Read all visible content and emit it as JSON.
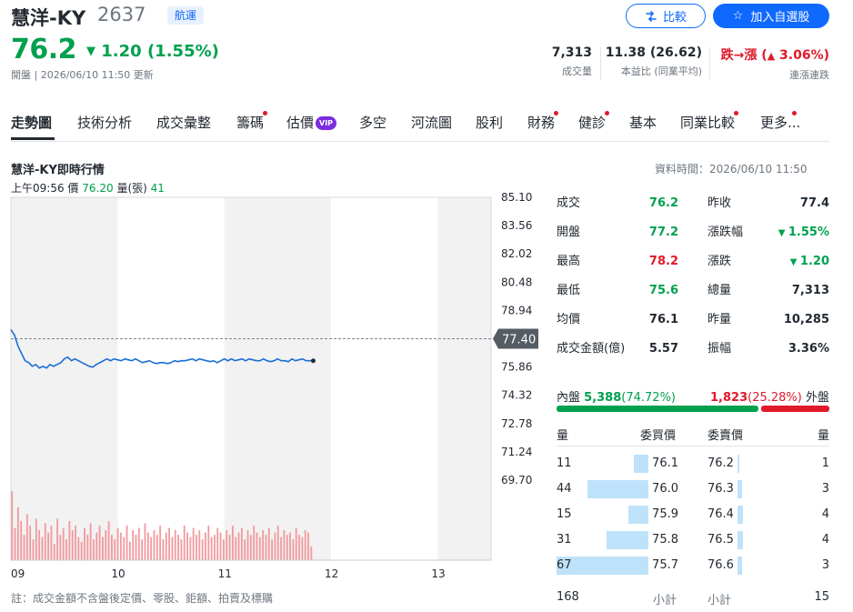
{
  "stock": {
    "name": "慧洋-KY",
    "code": "2637",
    "industry": "航運",
    "compare_label": "比較",
    "watchlist_label": "加入自選股",
    "price": "76.2",
    "change": "1.20 (1.55%)",
    "status_prefix": "開盤",
    "status_time": "2026/06/10 11:50 更新"
  },
  "key_stats": [
    {
      "value": "7,313",
      "label": "成交量"
    },
    {
      "value": "11.38 (26.62)",
      "label": "本益比 (同業平均)"
    },
    {
      "value_main": "跌→漲 (",
      "value_pct": "3.06%)",
      "label": "連漲連跌"
    }
  ],
  "tabs": [
    {
      "label": "走勢圖",
      "dot": false
    },
    {
      "label": "技術分析",
      "dot": false
    },
    {
      "label": "成交彙整",
      "dot": false
    },
    {
      "label": "籌碼",
      "dot": true
    },
    {
      "label": "估價",
      "dot": false
    },
    {
      "label": "多空",
      "dot": false
    },
    {
      "label": "河流圖",
      "dot": false
    },
    {
      "label": "股利",
      "dot": false
    },
    {
      "label": "財務",
      "dot": true
    },
    {
      "label": "健診",
      "dot": true
    },
    {
      "label": "基本",
      "dot": false
    },
    {
      "label": "同業比較",
      "dot": true
    },
    {
      "label": "更多...",
      "dot": true
    }
  ],
  "vip_badge": "VIP",
  "chart_header": {
    "title": "慧洋-KY即時行情",
    "data_time": "資料時間：2026/06/10 11:50",
    "cursor_time": "上午09:56",
    "cursor_price_label": "價",
    "cursor_price": "76.20",
    "cursor_volume_label": "量(張)",
    "cursor_volume": "41"
  },
  "chart_data": {
    "type": "line",
    "x_ticks": [
      "09",
      "10",
      "11",
      "12",
      "13"
    ],
    "y_ticks": [
      "85.10",
      "83.56",
      "82.02",
      "80.48",
      "78.94",
      "77.40",
      "75.86",
      "74.32",
      "72.78",
      "71.24",
      "69.70"
    ],
    "ylim": [
      69.7,
      85.1
    ],
    "reference": "77.40",
    "reference_value": 77.4,
    "x_range_minutes": 270,
    "price_series": {
      "minutes": [
        0,
        2,
        4,
        6,
        8,
        10,
        12,
        14,
        16,
        18,
        20,
        22,
        24,
        26,
        28,
        30,
        32,
        34,
        36,
        38,
        40,
        42,
        44,
        46,
        48,
        50,
        52,
        54,
        56,
        58,
        60,
        62,
        64,
        66,
        68,
        70,
        72,
        74,
        76,
        78,
        80,
        82,
        84,
        86,
        88,
        90,
        92,
        94,
        96,
        98,
        100,
        102,
        104,
        106,
        108,
        110,
        112,
        114,
        116,
        118,
        120,
        122,
        124,
        126,
        128,
        130,
        132,
        134,
        136,
        138,
        140,
        142,
        144,
        146,
        148,
        150,
        152,
        154,
        156,
        158,
        160,
        162,
        164,
        166,
        168,
        170
      ],
      "values": [
        77.9,
        77.6,
        77.0,
        76.6,
        76.2,
        76.1,
        75.9,
        76.0,
        75.8,
        75.9,
        75.8,
        76.0,
        75.9,
        76.0,
        76.1,
        76.3,
        76.4,
        76.2,
        76.3,
        76.2,
        76.1,
        76.0,
        75.9,
        75.85,
        76.0,
        76.1,
        76.2,
        76.3,
        76.2,
        76.3,
        76.25,
        76.2,
        76.3,
        76.25,
        76.2,
        76.3,
        76.2,
        76.1,
        76.15,
        76.2,
        76.1,
        76.05,
        76.1,
        76.1,
        76.05,
        76.1,
        76.2,
        76.15,
        76.2,
        76.2,
        76.25,
        76.3,
        76.2,
        76.3,
        76.25,
        76.2,
        76.15,
        76.2,
        76.1,
        76.2,
        76.3,
        76.2,
        76.3,
        76.2,
        76.25,
        76.3,
        76.2,
        76.3,
        76.25,
        76.2,
        76.2,
        76.3,
        76.2,
        76.15,
        76.2,
        76.3,
        76.2,
        76.2,
        76.15,
        76.3,
        76.2,
        76.25,
        76.3,
        76.2,
        76.2,
        76.2
      ]
    },
    "volume_series": [
      60,
      28,
      46,
      34,
      22,
      40,
      30,
      18,
      36,
      26,
      20,
      32,
      24,
      30,
      14,
      36,
      22,
      28,
      18,
      34,
      26,
      30,
      20,
      16,
      28,
      22,
      32,
      18,
      24,
      30,
      20,
      26,
      34,
      22,
      18,
      28,
      24,
      20,
      30,
      16,
      26,
      22,
      28,
      18,
      32,
      24,
      20,
      26,
      22,
      30,
      18,
      24,
      28,
      20,
      26,
      22,
      18,
      30,
      24,
      20,
      28,
      22,
      26,
      18,
      24,
      30,
      20,
      22,
      28,
      24,
      18,
      26,
      22,
      30,
      20,
      24,
      28,
      18,
      26,
      22,
      30,
      24,
      20,
      26,
      22,
      28,
      18,
      24,
      30,
      20,
      26,
      22,
      24,
      18,
      28,
      22,
      20,
      26,
      24,
      12
    ],
    "volume_max": 60,
    "last_point_minute": 170,
    "last_point_value": 76.2,
    "grid": true,
    "colors": {
      "line": "#1a6dd6",
      "volume": "#f29a9f",
      "shade": "#f2f2f2",
      "reference": "#7d8590",
      "ref_label_bg": "#555c63"
    }
  },
  "quote": {
    "left": [
      {
        "label": "成交",
        "value": "76.2",
        "color": "green"
      },
      {
        "label": "開盤",
        "value": "77.2",
        "color": "green"
      },
      {
        "label": "最高",
        "value": "78.2",
        "color": "red"
      },
      {
        "label": "最低",
        "value": "75.6",
        "color": "green"
      },
      {
        "label": "均價",
        "value": "76.1",
        "color": "black"
      },
      {
        "label": "成交金額(億)",
        "value": "5.57",
        "color": "black"
      }
    ],
    "right": [
      {
        "label": "昨收",
        "value": "77.4",
        "color": "black"
      },
      {
        "label": "漲跌幅",
        "value": "1.55%",
        "color": "green",
        "arrow": true
      },
      {
        "label": "漲跌",
        "value": "1.20",
        "color": "green",
        "arrow": true
      },
      {
        "label": "總量",
        "value": "7,313",
        "color": "black"
      },
      {
        "label": "昨量",
        "value": "10,285",
        "color": "black"
      },
      {
        "label": "振幅",
        "value": "3.36%",
        "color": "black"
      }
    ]
  },
  "inner_outer": {
    "inner_label": "內盤",
    "inner_value": "5,388",
    "inner_pct": "(74.72%)",
    "inner_ratio": 0.7472,
    "outer_value": "1,823",
    "outer_pct": "(25.28%)",
    "outer_label": "外盤",
    "colors": {
      "inner": "#00a04f",
      "outer": "#e0192b"
    }
  },
  "order_book": {
    "headers": {
      "bid_qty": "量",
      "bid_price": "委買價",
      "ask_price": "委賣價",
      "ask_qty": "量"
    },
    "bids": [
      {
        "qty": "11",
        "price": "76.1",
        "ratio": 0.16
      },
      {
        "qty": "44",
        "price": "76.0",
        "ratio": 0.66
      },
      {
        "qty": "15",
        "price": "75.9",
        "ratio": 0.22
      },
      {
        "qty": "31",
        "price": "75.8",
        "ratio": 0.46
      },
      {
        "qty": "67",
        "price": "75.7",
        "ratio": 1.0
      }
    ],
    "asks": [
      {
        "price": "76.2",
        "qty": "1",
        "ratio": 0.02
      },
      {
        "price": "76.3",
        "qty": "3",
        "ratio": 0.05
      },
      {
        "price": "76.4",
        "qty": "4",
        "ratio": 0.06
      },
      {
        "price": "76.5",
        "qty": "4",
        "ratio": 0.06
      },
      {
        "price": "76.6",
        "qty": "3",
        "ratio": 0.05
      }
    ],
    "bid_total": "168",
    "subtotal_label": "小計",
    "ask_total": "15"
  },
  "footnote": "註：成交金額不含盤後定價、零股、鉅額、拍賣及標購"
}
